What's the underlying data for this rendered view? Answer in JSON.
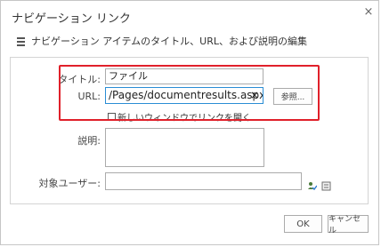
{
  "dialog": {
    "title": "ナビゲーション リンク",
    "close_glyph": "×",
    "subtitle": "ナビゲーション アイテムのタイトル、URL、および説明の編集"
  },
  "form": {
    "title_label": "タイトル:",
    "title_value": "ファイル",
    "url_label": "URL:",
    "url_value": "/Pages/documentresults.aspx",
    "url_clear_glyph": "×",
    "browse_label": "参照...",
    "new_window_label": "新しいウィンドウでリンクを開く",
    "new_window_checked": false,
    "description_label": "説明:",
    "description_value": "",
    "audience_label": "対象ユーザー:",
    "audience_value": ""
  },
  "buttons": {
    "ok": "OK",
    "cancel": "キャンセル"
  },
  "colors": {
    "highlight": "#e0202a",
    "focus_border": "#2a8dd4"
  },
  "icons": {
    "document": "document-list-icon",
    "check_names": "check-names-icon",
    "browse_people": "address-book-icon"
  }
}
